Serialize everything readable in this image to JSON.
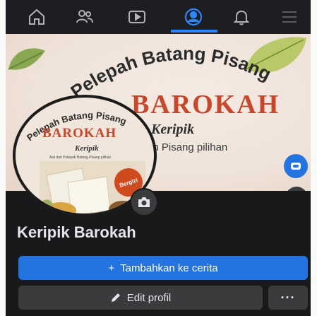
{
  "nav": {
    "items": [
      {
        "icon": "home-icon",
        "active": false
      },
      {
        "icon": "friends-icon",
        "active": false
      },
      {
        "icon": "video-icon",
        "active": false
      },
      {
        "icon": "profile-icon",
        "active": true
      },
      {
        "icon": "bell-icon",
        "active": false
      },
      {
        "icon": "menu-icon",
        "active": false
      }
    ]
  },
  "cover": {
    "arc_title": "Pelepah Batang Pisang",
    "brand": "BAROKAH",
    "tagline": "Keripik",
    "subline": "ah Pisang pilihan"
  },
  "avatar": {
    "arc_title": "Pelepah Batang Pisang",
    "brand": "BAROKAH",
    "tagline": "Keripik",
    "subline": "Asli dari Pelepah Batang Pisang pilihan",
    "badge": "Bergizi"
  },
  "profile": {
    "name": "Keripik Barokah"
  },
  "actions": {
    "add_story_icon": "+",
    "add_story_label": "Tambahkan ke cerita",
    "edit_profile_label": "Edit profil",
    "more_label": "···"
  },
  "colors": {
    "accent": "#2374e1",
    "brand_red": "#c9462b",
    "background": "#18191a",
    "button_dark": "#3a3b3c"
  }
}
